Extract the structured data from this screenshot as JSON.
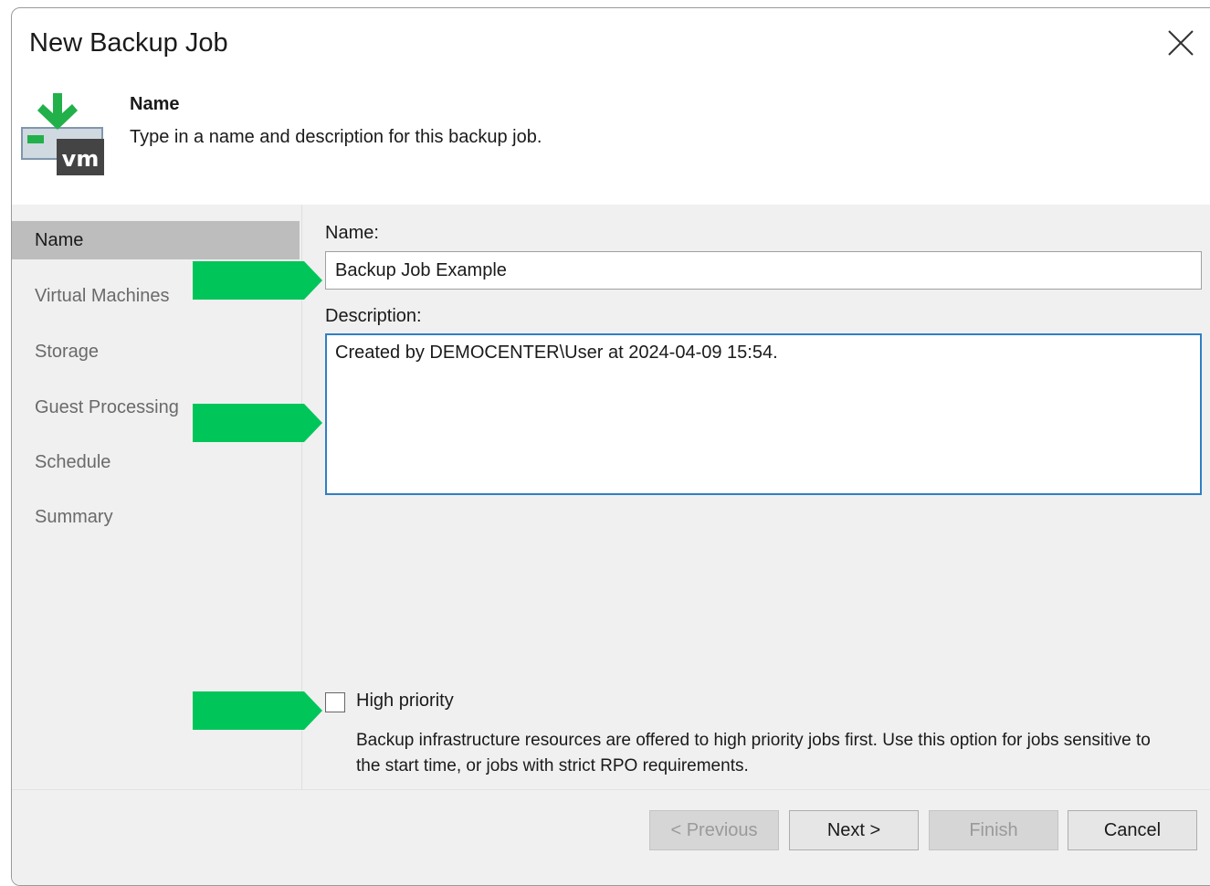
{
  "window": {
    "title": "New Backup Job"
  },
  "header": {
    "step_title": "Name",
    "step_description": "Type in a name and description for this backup job.",
    "icon_badge": "vm"
  },
  "sidebar": {
    "items": [
      {
        "label": "Name",
        "active": true
      },
      {
        "label": "Virtual Machines",
        "active": false
      },
      {
        "label": "Storage",
        "active": false
      },
      {
        "label": "Guest Processing",
        "active": false
      },
      {
        "label": "Schedule",
        "active": false
      },
      {
        "label": "Summary",
        "active": false
      }
    ]
  },
  "form": {
    "name_label": "Name:",
    "name_value": "Backup Job Example",
    "description_label": "Description:",
    "description_value": "Created by DEMOCENTER\\User at 2024-04-09 15:54.",
    "high_priority_label": "High priority",
    "high_priority_checked": false,
    "high_priority_help": "Backup infrastructure resources are offered to high priority jobs first. Use this option for jobs sensitive to the start time, or jobs with strict RPO requirements."
  },
  "footer": {
    "previous_label": "< Previous",
    "next_label": "Next >",
    "finish_label": "Finish",
    "cancel_label": "Cancel"
  },
  "colors": {
    "accent_arrow": "#00c65a",
    "focus_border": "#2f7fc4",
    "sidebar_active": "#bdbdbd"
  }
}
